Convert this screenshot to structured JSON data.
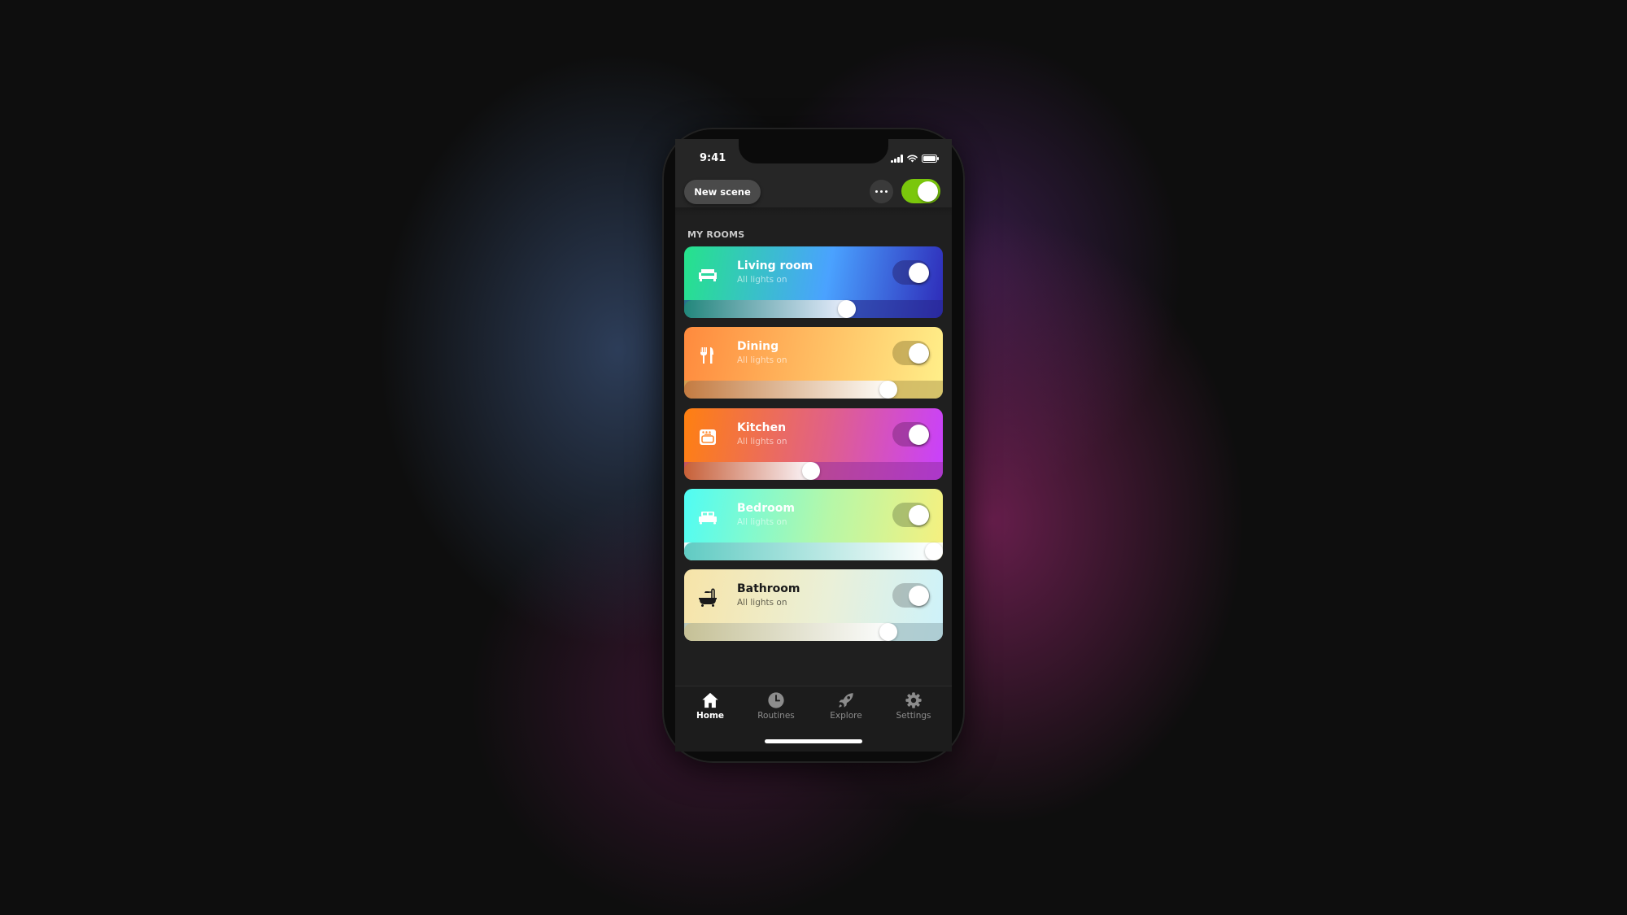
{
  "status_bar": {
    "time": "9:41"
  },
  "header": {
    "new_scene_label": "New scene",
    "more_icon": "more-horizontal-icon",
    "master_toggle": {
      "on": true,
      "color": "#7ac70c"
    }
  },
  "section_title": "MY ROOMS",
  "rooms": [
    {
      "name": "Living room",
      "status": "All lights on",
      "icon": "sofa-icon",
      "on": true,
      "brightness_percent": 63,
      "gradient": [
        "#25e38a",
        "#4aa2ff",
        "#2e2ab8"
      ],
      "text_color": "#ffffff"
    },
    {
      "name": "Dining",
      "status": "All lights on",
      "icon": "fork-knife-icon",
      "on": true,
      "brightness_percent": 79,
      "gradient": [
        "#ff8a3d",
        "#ffc266",
        "#fff08a"
      ],
      "text_color": "#ffffff"
    },
    {
      "name": "Kitchen",
      "status": "All lights on",
      "icon": "oven-icon",
      "on": true,
      "brightness_percent": 49,
      "gradient": [
        "#ff8010",
        "#e0608a",
        "#c840ff"
      ],
      "text_color": "#ffffff"
    },
    {
      "name": "Bedroom",
      "status": "All lights on",
      "icon": "bed-icon",
      "on": true,
      "brightness_percent": 100,
      "gradient": [
        "#4ffcf4",
        "#b6f7a8",
        "#f7f07e"
      ],
      "text_color": "#ffffff"
    },
    {
      "name": "Bathroom",
      "status": "All lights on",
      "icon": "bathtub-icon",
      "on": true,
      "brightness_percent": 79,
      "gradient": [
        "#f7e4a8",
        "#eaf0d8",
        "#cdf2fb"
      ],
      "text_color": "#1a1a1a"
    }
  ],
  "tabbar": {
    "items": [
      {
        "label": "Home",
        "icon": "home-icon",
        "active": true
      },
      {
        "label": "Routines",
        "icon": "clock-icon",
        "active": false
      },
      {
        "label": "Explore",
        "icon": "rocket-icon",
        "active": false
      },
      {
        "label": "Settings",
        "icon": "gear-icon",
        "active": false
      }
    ]
  }
}
